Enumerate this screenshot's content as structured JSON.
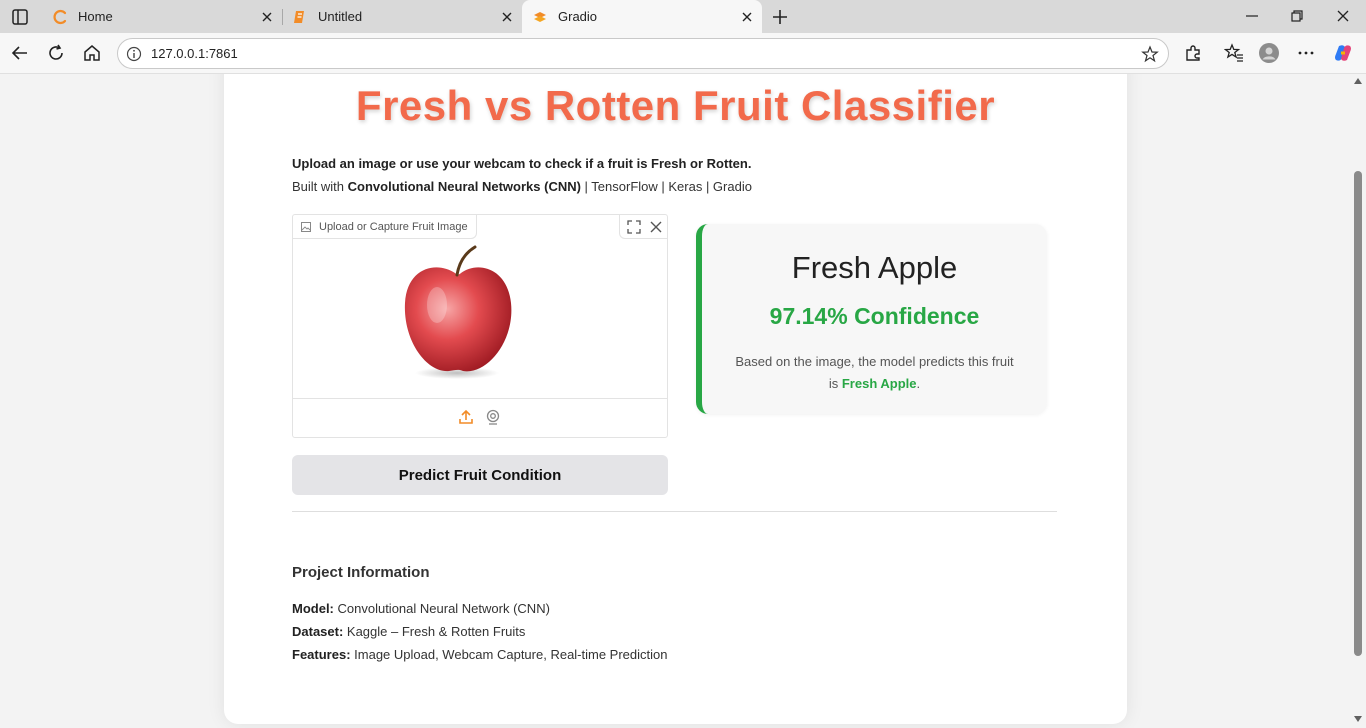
{
  "browser": {
    "tabs": [
      {
        "title": "Home",
        "active": false
      },
      {
        "title": "Untitled",
        "active": false
      },
      {
        "title": "Gradio",
        "active": true
      }
    ],
    "url": "127.0.0.1:7861"
  },
  "app": {
    "title": "Fresh vs Rotten Fruit Classifier",
    "intro_line1": "Upload an image or use your webcam to check if a fruit is Fresh or Rotten.",
    "intro_prefix": "Built with ",
    "intro_bold": "Convolutional Neural Networks (CNN)",
    "intro_suffix": " | TensorFlow | Keras | Gradio",
    "image_input": {
      "label": "Upload or Capture Fruit Image"
    },
    "predict_button": "Predict Fruit Condition",
    "result": {
      "label": "Fresh Apple",
      "confidence": "97.14% Confidence",
      "desc_prefix": "Based on the image, the model predicts this fruit is ",
      "desc_label": "Fresh Apple",
      "desc_suffix": "."
    },
    "project": {
      "heading": "Project Information",
      "model_key": "Model:",
      "model_val": " Convolutional Neural Network (CNN)",
      "dataset_key": "Dataset:",
      "dataset_val": " Kaggle – Fresh & Rotten Fruits",
      "features_key": "Features:",
      "features_val": " Image Upload, Webcam Capture, Real-time Prediction"
    }
  },
  "colors": {
    "title": "#f26a4b",
    "fresh_green": "#28a745",
    "accent_orange": "#f28c28"
  },
  "icons": [
    "sidebar-icon",
    "home-tab-icon",
    "untitled-tab-icon",
    "gradio-tab-icon",
    "close-icon",
    "plus-icon",
    "minimize-icon",
    "restore-icon",
    "back-icon",
    "refresh-icon",
    "home-icon",
    "info-icon",
    "star-icon",
    "extensions-icon",
    "favorites-icon",
    "profile-icon",
    "more-icon",
    "copilot-icon",
    "image-icon",
    "fullscreen-icon",
    "upload-icon",
    "webcam-icon"
  ]
}
